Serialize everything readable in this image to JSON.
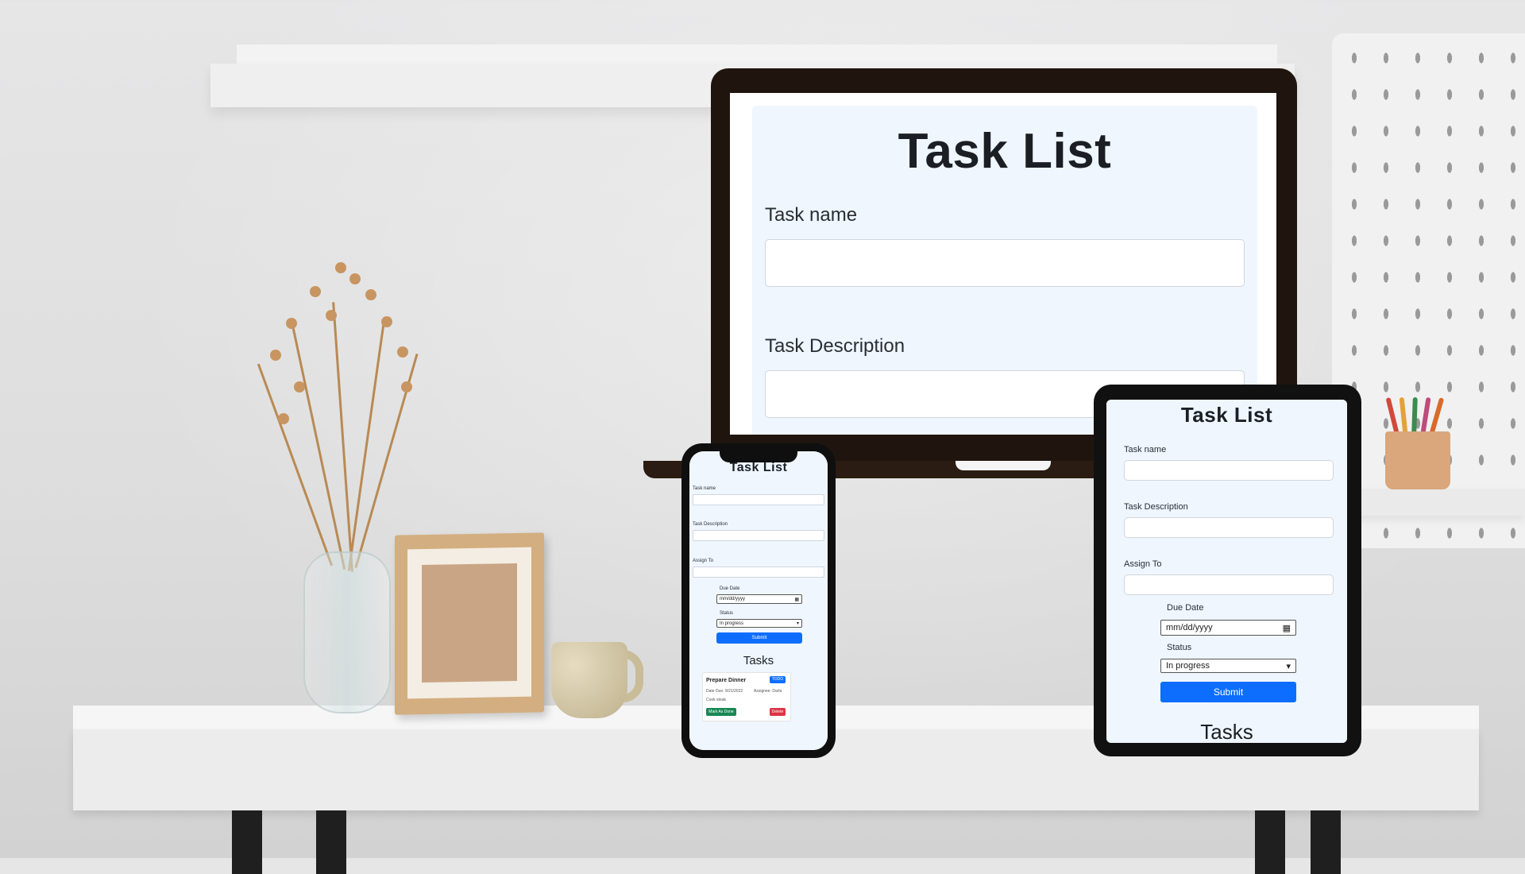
{
  "app": {
    "title": "Task List",
    "task_name_label": "Task name",
    "task_description_label": "Task Description",
    "assign_to_label": "Assign To",
    "due_date_label": "Due Date",
    "due_date_placeholder": "mm/dd/yyyy",
    "status_label": "Status",
    "status_selected": "In progress",
    "submit_label": "Submit",
    "tasks_heading": "Tasks"
  },
  "task_card": {
    "name": "Prepare Dinner",
    "status_badge": "TODO",
    "due": "Date Due: 9/21/2022",
    "assignee": "Assignee: Darla",
    "description": "Cook steak",
    "mark_done_label": "Mark As Done",
    "delete_label": "Delete"
  },
  "icons": {
    "calendar": "calendar-icon",
    "dropdown": "chevron-down-icon"
  },
  "colors": {
    "primary": "#0d6efd",
    "success": "#198754",
    "danger": "#dc3545",
    "card_bg": "#eff6fe"
  }
}
